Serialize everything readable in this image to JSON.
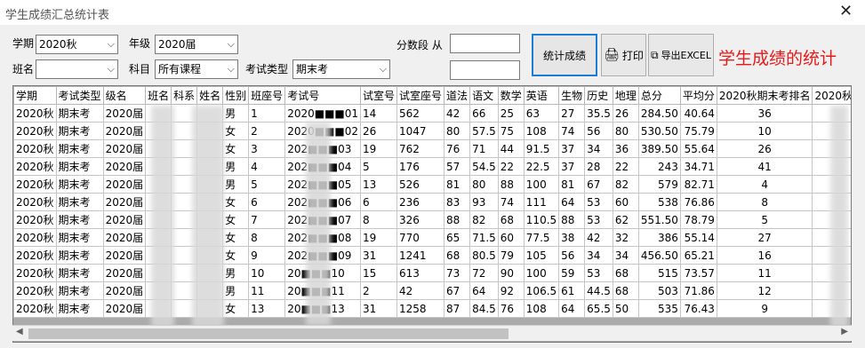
{
  "window": {
    "title": "学生成绩汇总统计表",
    "close_glyph": "✕"
  },
  "filters": {
    "term_label": "学期",
    "term_value": "2020秋",
    "grade_label": "年级",
    "grade_value": "2020届",
    "class_label": "班名",
    "class_value": "",
    "subject_label": "科目",
    "subject_value": "所有课程",
    "exam_type_label": "考试类型",
    "exam_type_value": "期末考",
    "score_range_label": "分数段 从"
  },
  "buttons": {
    "stat_label": "统计成绩",
    "print_label": "打印",
    "export_label": "导出EXCEL"
  },
  "caption": "学生成绩的统计",
  "table": {
    "headers": [
      "学期",
      "考试类型",
      "级名",
      "班名",
      "科系",
      "姓名",
      "性别",
      "班座号",
      "考试号",
      "试室号",
      "试室座号",
      "道法",
      "语文",
      "数学",
      "英语",
      "生物",
      "历史",
      "地理",
      "总分",
      "平均分",
      "2020秋期末考排名",
      "2020秋期末"
    ],
    "rows": [
      [
        "2020秋",
        "期末考",
        "2020届",
        "",
        "",
        "",
        "男",
        "1",
        "2020■■■01",
        "14",
        "562",
        "42",
        "66",
        "25",
        "63",
        "27",
        "35.5",
        "26",
        "284.50",
        "40.64",
        "36",
        ""
      ],
      [
        "2020秋",
        "期末考",
        "2020届",
        "",
        "",
        "",
        "女",
        "2",
        "2020■■■02",
        "26",
        "1047",
        "80",
        "57.5",
        "75",
        "108",
        "74",
        "56",
        "80",
        "530.50",
        "75.79",
        "10",
        ""
      ],
      [
        "2020秋",
        "期末考",
        "2020届",
        "",
        "",
        "",
        "女",
        "3",
        "202■■■03",
        "19",
        "762",
        "76",
        "71",
        "44",
        "91.5",
        "37",
        "34",
        "36",
        "389.50",
        "55.64",
        "26",
        ""
      ],
      [
        "2020秋",
        "期末考",
        "2020届",
        "",
        "",
        "",
        "男",
        "4",
        "202■■■04",
        "5",
        "176",
        "57",
        "54.5",
        "22",
        "22.5",
        "37",
        "28",
        "22",
        "243",
        "34.71",
        "41",
        ""
      ],
      [
        "2020秋",
        "期末考",
        "2020届",
        "",
        "",
        "",
        "男",
        "5",
        "202■■■05",
        "13",
        "526",
        "81",
        "80",
        "88",
        "100",
        "81",
        "67",
        "82",
        "579",
        "82.71",
        "4",
        ""
      ],
      [
        "2020秋",
        "期末考",
        "2020届",
        "",
        "",
        "",
        "女",
        "6",
        "202■■■06",
        "6",
        "236",
        "83",
        "93",
        "74",
        "111",
        "64",
        "53",
        "60",
        "538",
        "76.86",
        "8",
        ""
      ],
      [
        "2020秋",
        "期末考",
        "2020届",
        "",
        "",
        "",
        "女",
        "7",
        "202■■■07",
        "8",
        "326",
        "88",
        "82",
        "68",
        "110.5",
        "88",
        "53",
        "62",
        "551.50",
        "78.79",
        "5",
        ""
      ],
      [
        "2020秋",
        "期末考",
        "2020届",
        "",
        "",
        "",
        "女",
        "8",
        "202■■■08",
        "19",
        "770",
        "65",
        "71.5",
        "60",
        "77.5",
        "38",
        "42",
        "32",
        "386",
        "55.14",
        "27",
        ""
      ],
      [
        "2020秋",
        "期末考",
        "2020届",
        "",
        "",
        "",
        "女",
        "9",
        "202■■■09",
        "31",
        "1241",
        "68",
        "80.5",
        "79",
        "105",
        "56",
        "34",
        "34",
        "456.50",
        "65.21",
        "16",
        ""
      ],
      [
        "2020秋",
        "期末考",
        "2020届",
        "",
        "",
        "",
        "男",
        "10",
        "20■■■10",
        "15",
        "613",
        "73",
        "72",
        "90",
        "100",
        "59",
        "53",
        "68",
        "515",
        "73.57",
        "11",
        ""
      ],
      [
        "2020秋",
        "期末考",
        "2020届",
        "",
        "",
        "",
        "男",
        "11",
        "20■■■11",
        "2",
        "42",
        "67",
        "64",
        "92",
        "106.5",
        "61",
        "44.5",
        "68",
        "503",
        "71.86",
        "12",
        ""
      ],
      [
        "2020秋",
        "期末考",
        "2020届",
        "",
        "",
        "",
        "女",
        "13",
        "20■■■13",
        "31",
        "1258",
        "87",
        "84.5",
        "76",
        "108",
        "64",
        "65.5",
        "50",
        "535",
        "76.43",
        "9",
        ""
      ]
    ]
  }
}
